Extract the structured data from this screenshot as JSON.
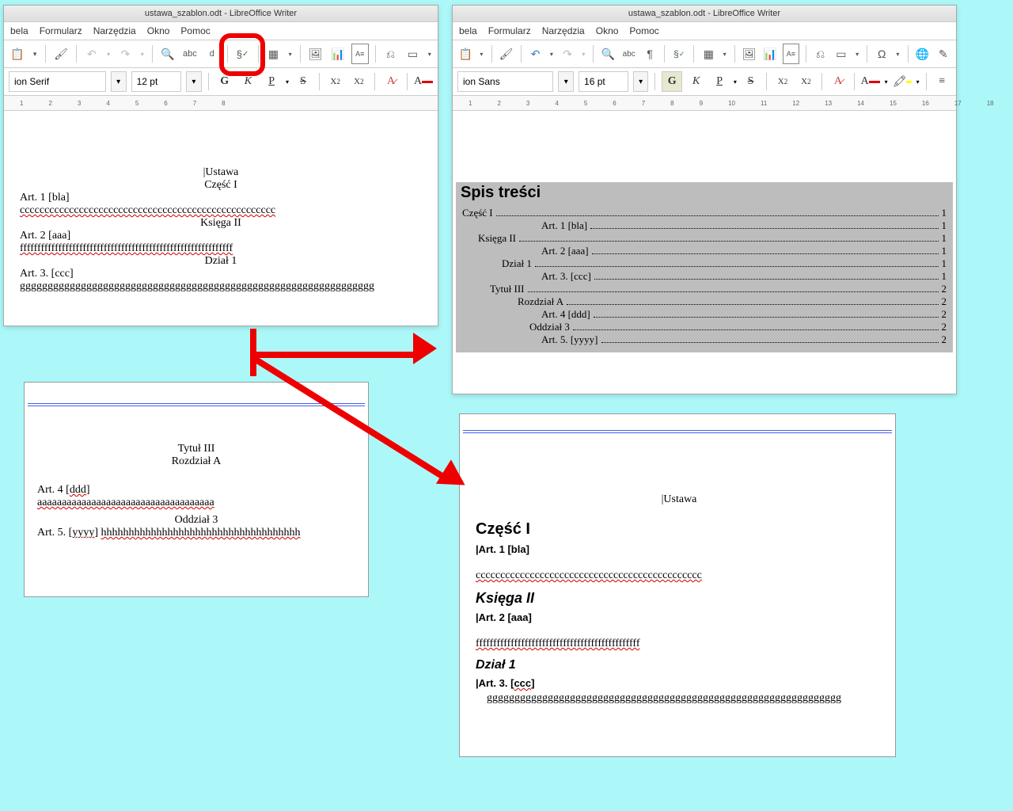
{
  "title": "ustawa_szablon.odt - LibreOffice Writer",
  "menus": [
    "bela",
    "Formularz",
    "Narzędzia",
    "Okno",
    "Pomoc"
  ],
  "fontLeft": {
    "name": "ion Serif",
    "size": "12 pt"
  },
  "fontRight": {
    "name": "ion Sans",
    "size": "16 pt"
  },
  "docLeft": {
    "ustawa": "Ustawa",
    "czesc": "Część I",
    "art1": "Art. 1 [bla]",
    "ccc": "cccccccccccccccccccccccccccccccccccccccccccccccccccc",
    "ksiega": "Księga II",
    "art2": "Art. 2 [aaa]",
    "fff": "fffffffffffffffffffffffffffffffffffffffffffffffffffffffffffff",
    "dzial": "Dział 1",
    "art3": "Art. 3.  [ccc]   ",
    "ggg": "gggggggggggggggggggggggggggggggggggggggggggggggggggggggggggggggg"
  },
  "snippet1": {
    "tytul": "Tytuł III",
    "rozdzial": "Rozdział A",
    "art4": "Art. 4 [ddd]",
    "aaa": "aaaaaaaaaaaaaaaaaaaaaaaaaaaaaaaaaaaa",
    "oddzial": "Oddział 3",
    "art5": "Art. 5. [yyyy] ",
    "hhh": "hhhhhhhhhhhhhhhhhhhhhhhhhhhhhhhhhhhh"
  },
  "toc": {
    "title": "Spis treści",
    "items": [
      {
        "label": "Część I",
        "page": "1",
        "indent": "indent1"
      },
      {
        "label": "Art. 1 [bla]",
        "page": "1",
        "indent": "indent2"
      },
      {
        "label": "Księga II",
        "page": "1",
        "indent": "indent3"
      },
      {
        "label": "Art. 2 [aaa]",
        "page": "1",
        "indent": "indent2"
      },
      {
        "label": "Dział 1",
        "page": "1",
        "indent": "indent4"
      },
      {
        "label": "Art. 3. [ccc]",
        "page": "1",
        "indent": "indent2"
      },
      {
        "label": "Tytuł III",
        "page": "2",
        "indent": "indent5"
      },
      {
        "label": "Rozdział A",
        "page": "2",
        "indent": "indent6"
      },
      {
        "label": "Art. 4 [ddd]",
        "page": "2",
        "indent": "indent2"
      },
      {
        "label": "Oddział 3",
        "page": "2",
        "indent": "indent7"
      },
      {
        "label": "Art. 5. [yyyy]",
        "page": "2",
        "indent": "indent2"
      }
    ]
  },
  "docRight": {
    "ustawa": "Ustawa",
    "czesc": "Część I",
    "art1": "Art. 1 [bla]",
    "ccc": "cccccccccccccccccccccccccccccccccccccccccccccc",
    "ksiega": "Księga II",
    "art2": "Art. 2 [aaa]",
    "fff": "fffffffffffffffffffffffffffffffffffffffffffffff",
    "dzial": "Dział 1",
    "art3": "Art. 3.  [ccc]",
    "ggg": "gggggggggggggggggggggggggggggggggggggggggggggggggggggggggggggggg"
  },
  "ruler1": [
    "1",
    "2",
    "3",
    "4",
    "5",
    "6",
    "7",
    "8"
  ],
  "ruler2": [
    "1",
    "2",
    "3",
    "4",
    "5",
    "6",
    "7",
    "8",
    "9",
    "10",
    "11",
    "12",
    "13",
    "14",
    "15",
    "16",
    "17",
    "18"
  ]
}
